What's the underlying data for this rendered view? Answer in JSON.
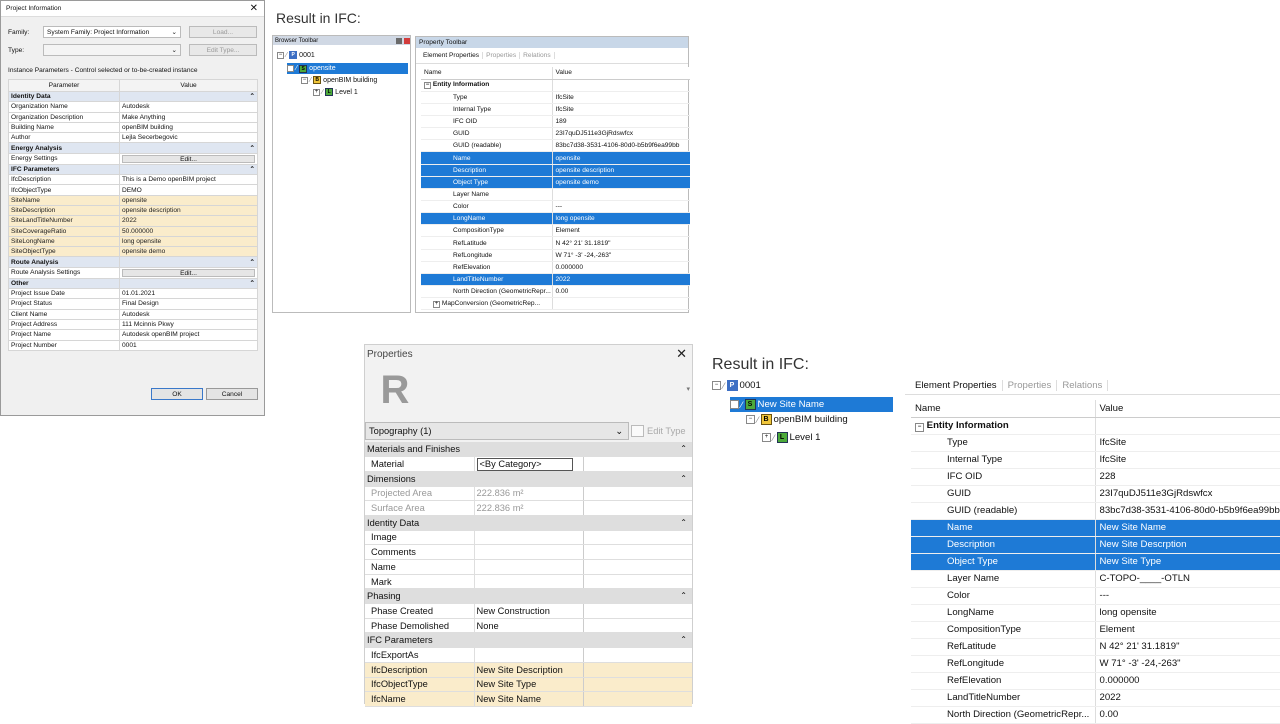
{
  "dialog": {
    "title": "Project Information",
    "close": "✕",
    "family_label": "Family:",
    "family_value": "System Family: Project Information",
    "type_label": "Type:",
    "type_value": "",
    "load_button": "Load...",
    "edit_type_button": "Edit Type...",
    "instance_note": "Instance Parameters - Control selected or to-be-created instance",
    "col_parameter": "Parameter",
    "col_value": "Value",
    "rows": [
      {
        "k": "Identity Data",
        "v": "",
        "group": true
      },
      {
        "k": "Organization Name",
        "v": "Autodesk"
      },
      {
        "k": "Organization Description",
        "v": "Make Anything"
      },
      {
        "k": "Building Name",
        "v": "openBIM building"
      },
      {
        "k": "Author",
        "v": "Lejla Secerbegovic"
      },
      {
        "k": "Energy Analysis",
        "v": "",
        "group": true
      },
      {
        "k": "Energy Settings",
        "v": "Edit...",
        "button": true
      },
      {
        "k": "IFC Parameters",
        "v": "",
        "group": true
      },
      {
        "k": "IfcDescription",
        "v": "This is a Demo openBIM project"
      },
      {
        "k": "IfcObjectType",
        "v": "DEMO"
      },
      {
        "k": "SiteName",
        "v": "opensite",
        "hl": true
      },
      {
        "k": "SiteDescription",
        "v": "opensite description",
        "hl": true
      },
      {
        "k": "SiteLandTitleNumber",
        "v": "2022",
        "hl": true
      },
      {
        "k": "SiteCoverageRatio",
        "v": "50.000000",
        "hl": true
      },
      {
        "k": "SiteLongName",
        "v": "long opensite",
        "hl": true
      },
      {
        "k": "SiteObjectType",
        "v": "opensite demo",
        "hl": true
      },
      {
        "k": "Route Analysis",
        "v": "",
        "group": true
      },
      {
        "k": "Route Analysis Settings",
        "v": "Edit...",
        "button": true
      },
      {
        "k": "Other",
        "v": "",
        "group": true
      },
      {
        "k": "Project Issue Date",
        "v": "01.01.2021"
      },
      {
        "k": "Project Status",
        "v": "Final Design"
      },
      {
        "k": "Client Name",
        "v": "Autodesk"
      },
      {
        "k": "Project Address",
        "v": "111 Mcinnis Pkwy"
      },
      {
        "k": "Project Name",
        "v": "Autodesk openBIM project"
      },
      {
        "k": "Project Number",
        "v": "0001"
      }
    ],
    "ok": "OK",
    "cancel": "Cancel"
  },
  "result1": {
    "title": "Result in IFC:",
    "browser_title": "Browser Toolbar",
    "tree": {
      "project": "0001",
      "site": "opensite",
      "building": "openBIM building",
      "level": "Level 1"
    },
    "toolbar_title": "Property Toolbar",
    "tabs": [
      "Element Properties",
      "Properties",
      "Relations"
    ],
    "col_name": "Name",
    "col_value": "Value",
    "section": "Entity Information",
    "rows": [
      {
        "k": "Type",
        "v": "IfcSite"
      },
      {
        "k": "Internal Type",
        "v": "IfcSite"
      },
      {
        "k": "IFC OID",
        "v": "189"
      },
      {
        "k": "GUID",
        "v": "23I7quDJ511e3GjRdswfcx"
      },
      {
        "k": "GUID (readable)",
        "v": "83bc7d38-3531-4106-80d0-b5b9f6ea99bb"
      },
      {
        "k": "Name",
        "v": "opensite",
        "sel": true
      },
      {
        "k": "Description",
        "v": "opensite description",
        "sel": true
      },
      {
        "k": "Object Type",
        "v": "opensite demo",
        "sel": true
      },
      {
        "k": "Layer Name",
        "v": ""
      },
      {
        "k": "Color",
        "v": "---"
      },
      {
        "k": "LongName",
        "v": "long opensite",
        "sel": true
      },
      {
        "k": "CompositionType",
        "v": "Element"
      },
      {
        "k": "RefLatitude",
        "v": "N 42° 21' 31.1819\""
      },
      {
        "k": "RefLongitude",
        "v": "W 71° -3' -24,-263\""
      },
      {
        "k": "RefElevation",
        "v": "0.000000"
      },
      {
        "k": "LandTitleNumber",
        "v": "2022",
        "sel": true
      },
      {
        "k": "North Direction (GeometricRepr...",
        "v": "0.00"
      },
      {
        "k": "MapConversion (GeometricRep...",
        "v": "",
        "expand": true
      }
    ]
  },
  "properties": {
    "title": "Properties",
    "close": "✕",
    "type_selector": "Topography (1)",
    "edit_type": "Edit Type",
    "rows": [
      {
        "k": "Materials and Finishes",
        "group": true
      },
      {
        "k": "Material",
        "v": "<By Category>",
        "box": true
      },
      {
        "k": "Dimensions",
        "group": true
      },
      {
        "k": "Projected Area",
        "v": "222.836 m²",
        "gray": true
      },
      {
        "k": "Surface Area",
        "v": "222.836 m²",
        "gray": true
      },
      {
        "k": "Identity Data",
        "group": true
      },
      {
        "k": "Image",
        "v": ""
      },
      {
        "k": "Comments",
        "v": ""
      },
      {
        "k": "Name",
        "v": ""
      },
      {
        "k": "Mark",
        "v": ""
      },
      {
        "k": "Phasing",
        "group": true
      },
      {
        "k": "Phase Created",
        "v": "New Construction"
      },
      {
        "k": "Phase Demolished",
        "v": "None"
      },
      {
        "k": "IFC Parameters",
        "group": true
      },
      {
        "k": "IfcExportAs",
        "v": ""
      },
      {
        "k": "IfcDescription",
        "v": "New Site Description",
        "hl": true
      },
      {
        "k": "IfcObjectType",
        "v": "New Site Type",
        "hl": true
      },
      {
        "k": "IfcName",
        "v": "New Site Name",
        "hl": true
      }
    ]
  },
  "result2": {
    "title": "Result in IFC:",
    "tree": {
      "project": "0001",
      "site": "New Site Name",
      "building": "openBIM building",
      "level": "Level 1"
    },
    "tabs": [
      "Element Properties",
      "Properties",
      "Relations"
    ],
    "col_name": "Name",
    "col_value": "Value",
    "section": "Entity Information",
    "rows": [
      {
        "k": "Type",
        "v": "IfcSite"
      },
      {
        "k": "Internal Type",
        "v": "IfcSite"
      },
      {
        "k": "IFC OID",
        "v": "228"
      },
      {
        "k": "GUID",
        "v": "23I7quDJ511e3GjRdswfcx"
      },
      {
        "k": "GUID (readable)",
        "v": "83bc7d38-3531-4106-80d0-b5b9f6ea99bb"
      },
      {
        "k": "Name",
        "v": "New Site Name",
        "sel": true
      },
      {
        "k": "Description",
        "v": "New Site Descrption",
        "sel": true
      },
      {
        "k": "Object Type",
        "v": "New Site Type",
        "sel": true
      },
      {
        "k": "Layer Name",
        "v": "C-TOPO-____-OTLN"
      },
      {
        "k": "Color",
        "v": "---"
      },
      {
        "k": "LongName",
        "v": "long opensite"
      },
      {
        "k": "CompositionType",
        "v": "Element"
      },
      {
        "k": "RefLatitude",
        "v": "N 42° 21' 31.1819\""
      },
      {
        "k": "RefLongitude",
        "v": "W 71° -3' -24,-263\""
      },
      {
        "k": "RefElevation",
        "v": "0.000000"
      },
      {
        "k": "LandTitleNumber",
        "v": "2022"
      },
      {
        "k": "North Direction (GeometricRepr...",
        "v": "0.00"
      }
    ]
  },
  "colors": {
    "selection": "#1e7ad6",
    "highlight": "#faeccb",
    "group_header": "#dfe6f1"
  }
}
